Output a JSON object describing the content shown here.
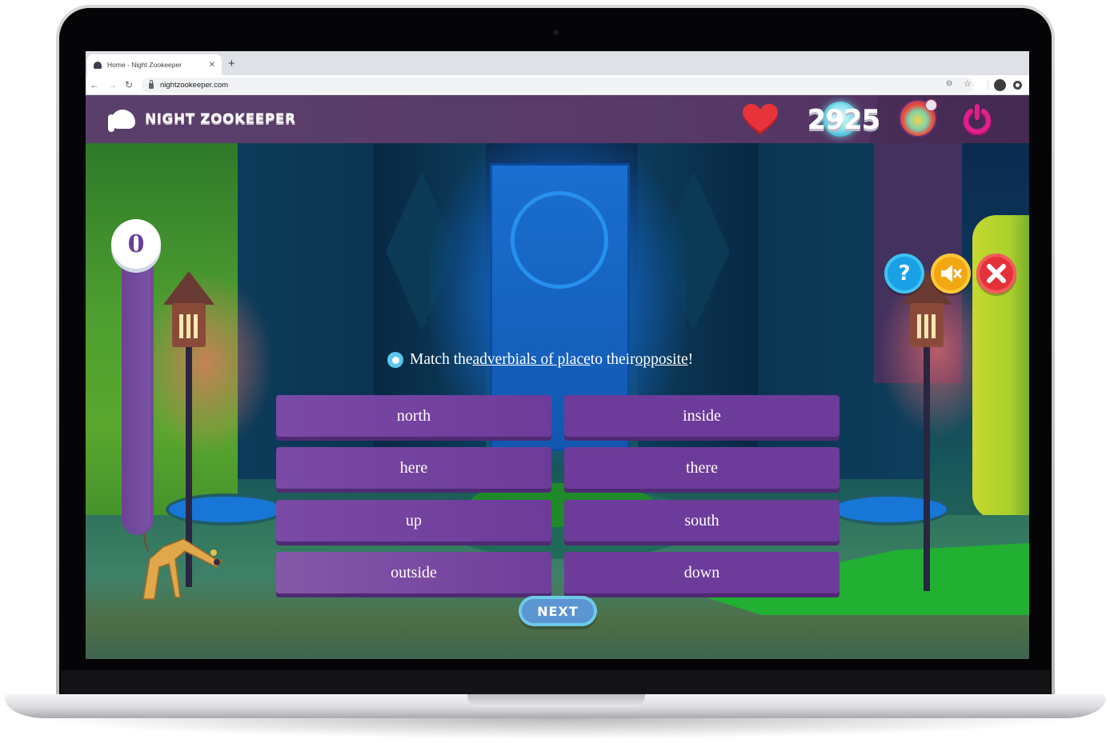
{
  "browser": {
    "tab_title": "Home - Night Zookeeper",
    "tab_close": "✕",
    "new_tab": "+",
    "back": "←",
    "forward": "→",
    "reload": "↻",
    "url": "nightzookeeper.com",
    "zoom_glyph": "⊖",
    "star_glyph": "☆"
  },
  "header": {
    "logo_text": "NIGHT ZOOKEEPER",
    "score": "2925"
  },
  "game": {
    "counter": "0",
    "progress_fraction": 0,
    "controls": {
      "help": "?",
      "mute": "🔇",
      "close": "✕"
    },
    "instruction": {
      "part1": "Match the ",
      "link1": "adverbials of place",
      "part2": " to their ",
      "link2": "opposite",
      "part3": "!"
    },
    "cards": [
      {
        "label": "north",
        "col": 0,
        "row": 0
      },
      {
        "label": "inside",
        "col": 1,
        "row": 0
      },
      {
        "label": "here",
        "col": 0,
        "row": 1
      },
      {
        "label": "there",
        "col": 1,
        "row": 1
      },
      {
        "label": "up",
        "col": 0,
        "row": 2
      },
      {
        "label": "south",
        "col": 1,
        "row": 2
      },
      {
        "label": "outside",
        "col": 0,
        "row": 3
      },
      {
        "label": "down",
        "col": 1,
        "row": 3
      }
    ],
    "next_label": "NEXT"
  },
  "colors": {
    "header_bg": "#573a67",
    "card_bg": "#6d3b99",
    "help": "#1aa0e5",
    "mute": "#f3a713",
    "close": "#e5323a",
    "power": "#e0208a",
    "heart": "#e8333a",
    "next": "#5b96d3"
  }
}
